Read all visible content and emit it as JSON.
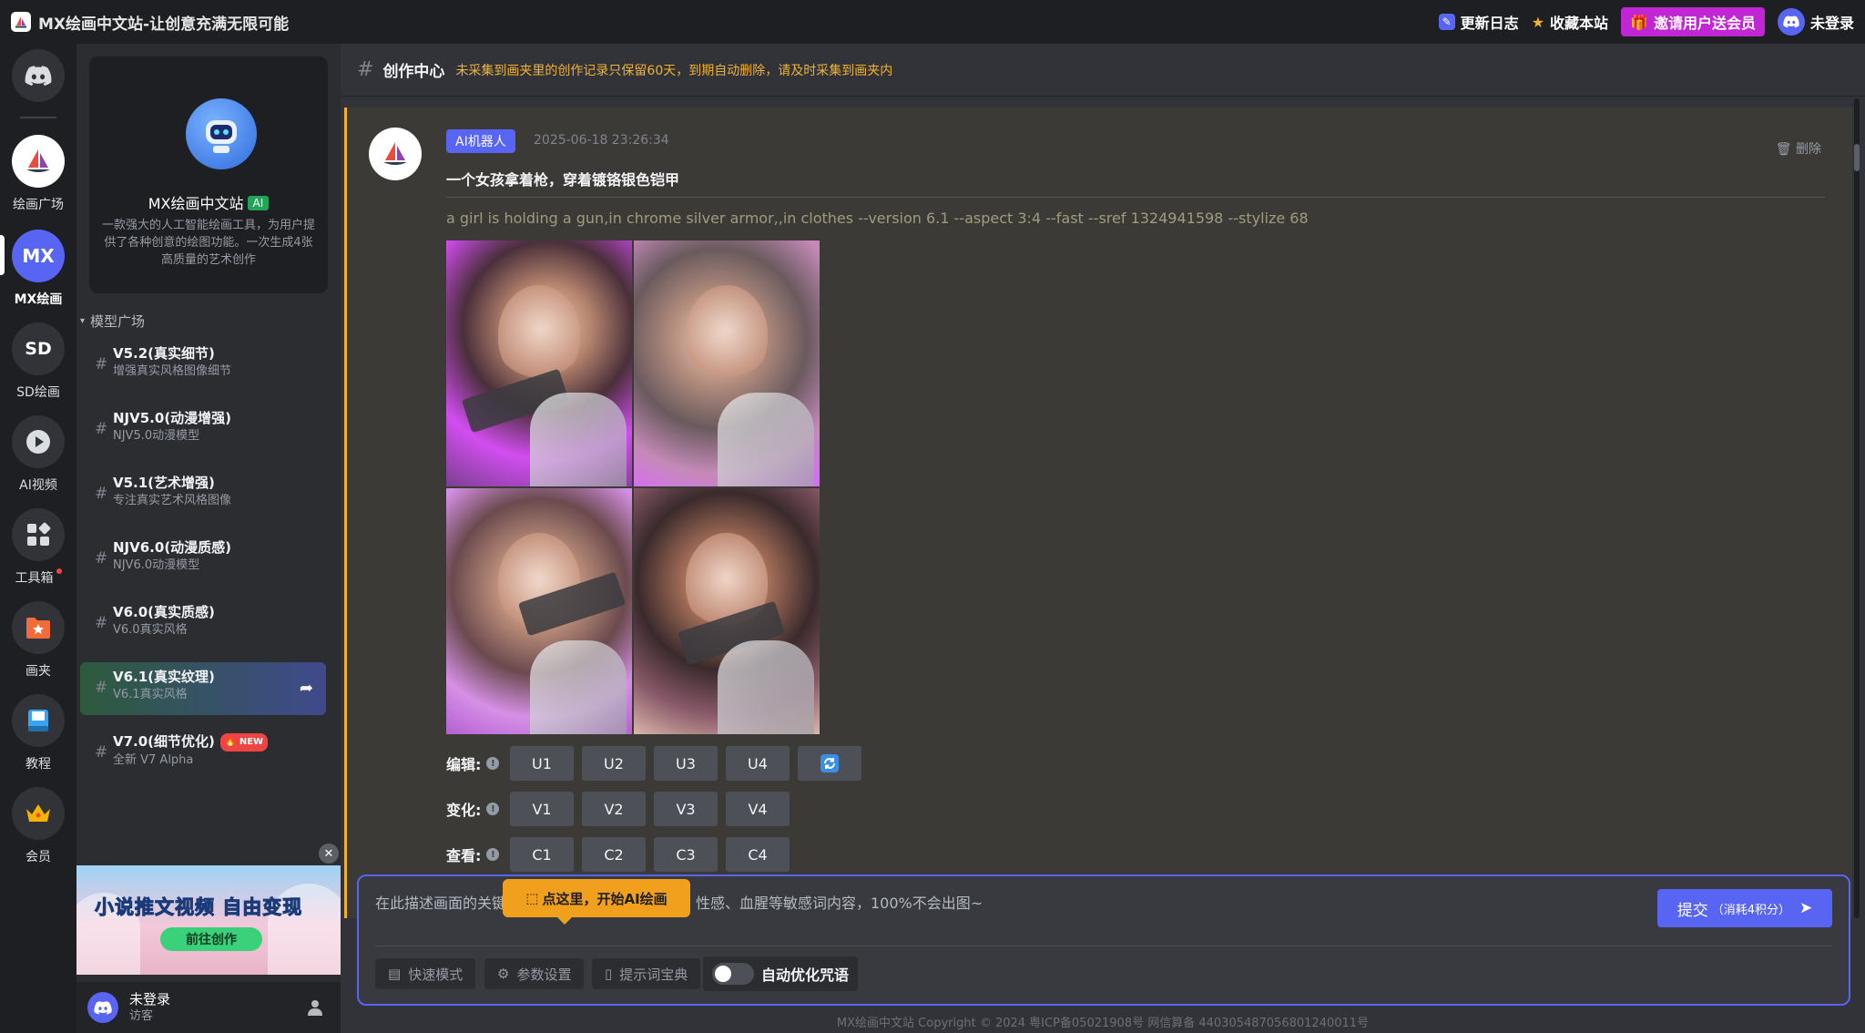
{
  "titlebar": {
    "title": "MX绘画中文站-让创意充满无限可能",
    "changelog": "更新日志",
    "bookmark": "收藏本站",
    "invite": "邀请用户送会员",
    "login": "未登录"
  },
  "rail": {
    "items": [
      {
        "label": "绘画广场",
        "icon": "sailboat-logo"
      },
      {
        "label": "MX绘画",
        "icon": "mx-badge"
      },
      {
        "label": "SD绘画",
        "icon": "sd-badge"
      },
      {
        "label": "AI视频",
        "icon": "play-icon"
      },
      {
        "label": "工具箱",
        "icon": "grid-icon"
      },
      {
        "label": "画夹",
        "icon": "folder-star-icon"
      },
      {
        "label": "教程",
        "icon": "book-icon"
      },
      {
        "label": "会员",
        "icon": "crown-icon"
      }
    ],
    "mx_badge_text": "MX",
    "sd_badge_text": "SD"
  },
  "sidebar": {
    "card_name": "MX绘画中文站",
    "card_tag": "AI",
    "card_desc": "一款强大的人工智能绘画工具，为用户提供了各种创意的绘图功能。一次生成4张高质量的艺术创作",
    "section": "模型广场",
    "models": [
      {
        "name": "V5.2(真实细节)",
        "sub": "增强真实风格图像细节"
      },
      {
        "name": "NJV5.0(动漫增强)",
        "sub": "NJV5.0动漫模型"
      },
      {
        "name": "V5.1(艺术增强)",
        "sub": "专注真实艺术风格图像"
      },
      {
        "name": "NJV6.0(动漫质感)",
        "sub": "NJV6.0动漫模型"
      },
      {
        "name": "V6.0(真实质感)",
        "sub": "V6.0真实风格"
      },
      {
        "name": "V6.1(真实纹理)",
        "sub": "V6.1真实风格"
      },
      {
        "name": "V7.0(细节优化)",
        "sub": "全新 V7 Alpha",
        "badge": "NEW"
      }
    ],
    "promo_title": "小说推文视频 自由变现",
    "promo_button": "前往创作",
    "user_name": "未登录",
    "user_role": "访客"
  },
  "main": {
    "channel": "创作中心",
    "notice": "未采集到画夹里的创作记录只保留60天，到期自动删除，请及时采集到画夹内",
    "message": {
      "badge": "AI机器人",
      "time": "2025-06-18 23:26:34",
      "delete": "删除",
      "prompt_cn": "一个女孩拿着枪，穿着镀铬银色铠甲",
      "prompt_en": "a girl is holding a gun,in chrome silver armor,,in clothes --version 6.1 --aspect 3:4 --fast --sref 1324941598 --stylize 68",
      "edit_label": "编辑:",
      "vary_label": "变化:",
      "view_label": "查看:",
      "u_buttons": [
        "U1",
        "U2",
        "U3",
        "U4"
      ],
      "v_buttons": [
        "V1",
        "V2",
        "V3",
        "V4"
      ],
      "c_buttons": [
        "C1",
        "C2",
        "C3",
        "C4"
      ]
    },
    "tooltip": "点这里，开始AI绘画",
    "composer": {
      "placeholder": "在此描述画面的关键词，注意不要在此填入萝莉、性感、血腥等敏感词内容，100%不会出图~",
      "submit": "提交",
      "submit_cost": "（消耗4积分）",
      "quick_mode": "快速模式",
      "params": "参数设置",
      "dictionary": "提示词宝典",
      "auto_opt": "自动优化咒语"
    },
    "footer": "MX绘画中文站 Copyright © 2024 粤ICP备05021908号 网信算备 440305487056801240011号"
  },
  "colors": {
    "accent": "#5865f2",
    "warning": "#f0b232",
    "invite": "#c026d3"
  }
}
